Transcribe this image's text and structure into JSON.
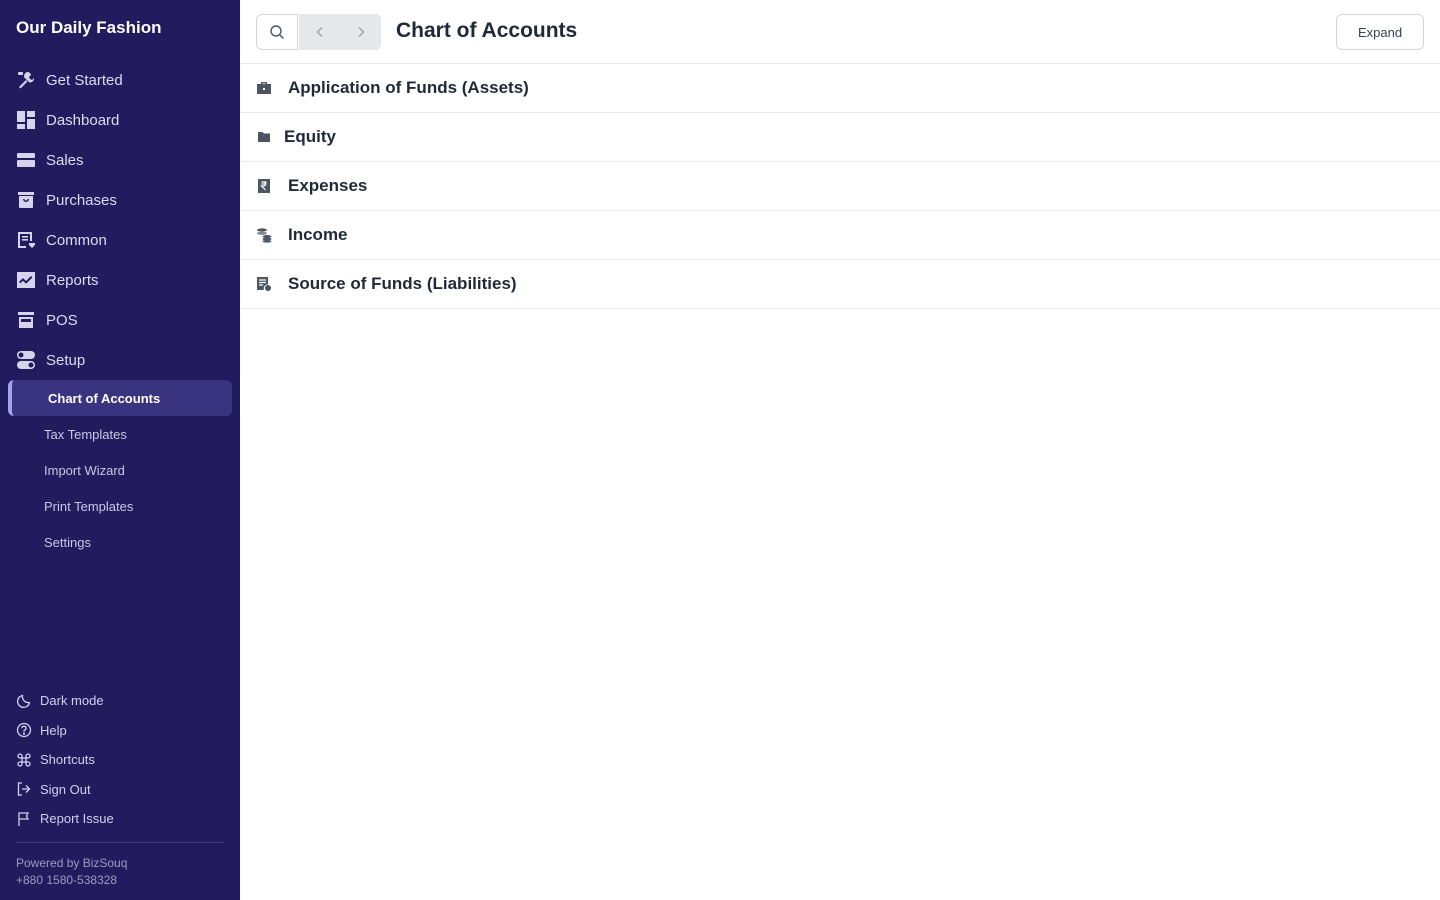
{
  "sidebar": {
    "brand": "Our Daily Fashion",
    "nav": [
      {
        "label": "Get Started",
        "icon": "tools-icon"
      },
      {
        "label": "Dashboard",
        "icon": "dashboard-icon"
      },
      {
        "label": "Sales",
        "icon": "sales-icon"
      },
      {
        "label": "Purchases",
        "icon": "purchases-icon"
      },
      {
        "label": "Common",
        "icon": "common-icon"
      },
      {
        "label": "Reports",
        "icon": "reports-icon"
      },
      {
        "label": "POS",
        "icon": "pos-icon"
      },
      {
        "label": "Setup",
        "icon": "setup-icon"
      }
    ],
    "setup_sub": [
      {
        "label": "Chart of Accounts",
        "active": true
      },
      {
        "label": "Tax Templates"
      },
      {
        "label": "Import Wizard"
      },
      {
        "label": "Print Templates"
      },
      {
        "label": "Settings"
      }
    ],
    "bottom": [
      {
        "label": "Dark mode",
        "icon": "moon-icon"
      },
      {
        "label": "Help",
        "icon": "help-icon"
      },
      {
        "label": "Shortcuts",
        "icon": "command-icon"
      },
      {
        "label": "Sign Out",
        "icon": "sign-out-icon"
      },
      {
        "label": "Report Issue",
        "icon": "flag-icon"
      }
    ],
    "powered_by": "Powered by BizSouq",
    "phone": "+880 1580-538328"
  },
  "header": {
    "title": "Chart of Accounts",
    "expand_label": "Expand"
  },
  "accounts": [
    {
      "label": "Application of Funds (Assets)",
      "icon": "briefcase-icon"
    },
    {
      "label": "Equity",
      "icon": "folder-icon"
    },
    {
      "label": "Expenses",
      "icon": "rupee-receipt-icon"
    },
    {
      "label": "Income",
      "icon": "coins-icon"
    },
    {
      "label": "Source of Funds (Liabilities)",
      "icon": "invoice-icon"
    }
  ],
  "colors": {
    "sidebar_bg": "#221c5f",
    "active_bg": "#3a3480",
    "accent": "#a7a2ea"
  }
}
